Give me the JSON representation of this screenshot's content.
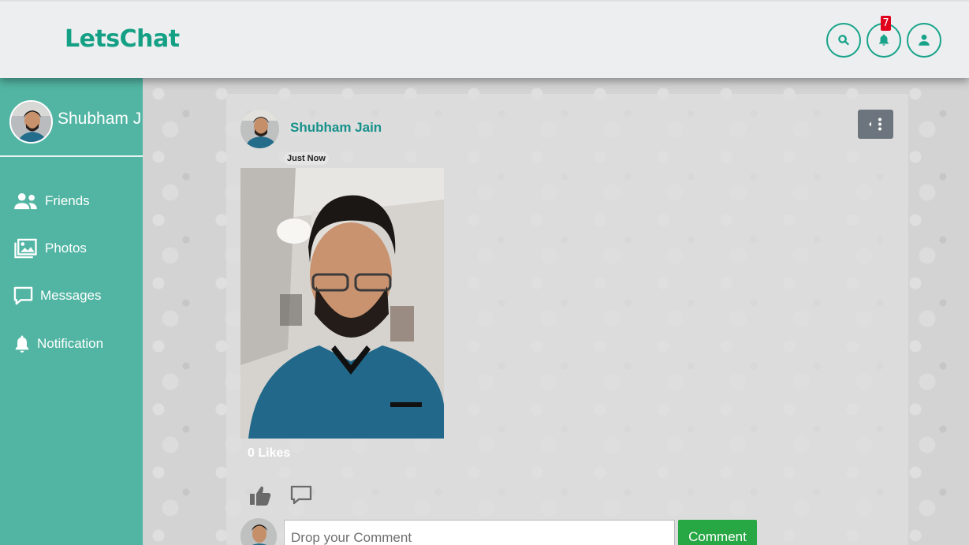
{
  "header": {
    "brand": "LetsChat",
    "notification_count": "7",
    "search_icon": "search-icon",
    "bell_icon": "bell-icon",
    "user_icon": "user-icon"
  },
  "sidebar": {
    "profile_name": "Shubham J",
    "items": [
      {
        "label": "Friends",
        "icon": "users-icon"
      },
      {
        "label": "Photos",
        "icon": "images-icon"
      },
      {
        "label": "Messages",
        "icon": "comment-icon"
      },
      {
        "label": "Notification",
        "icon": "bell-icon"
      }
    ]
  },
  "post": {
    "author": "Shubham Jain",
    "time": "Just Now",
    "likes": "0 Likes",
    "comment_placeholder": "Drop your Comment",
    "comment_button": "Comment"
  },
  "colors": {
    "brand": "#14a085",
    "sidebar": "#52b5a3",
    "comment_button": "#28a745"
  }
}
